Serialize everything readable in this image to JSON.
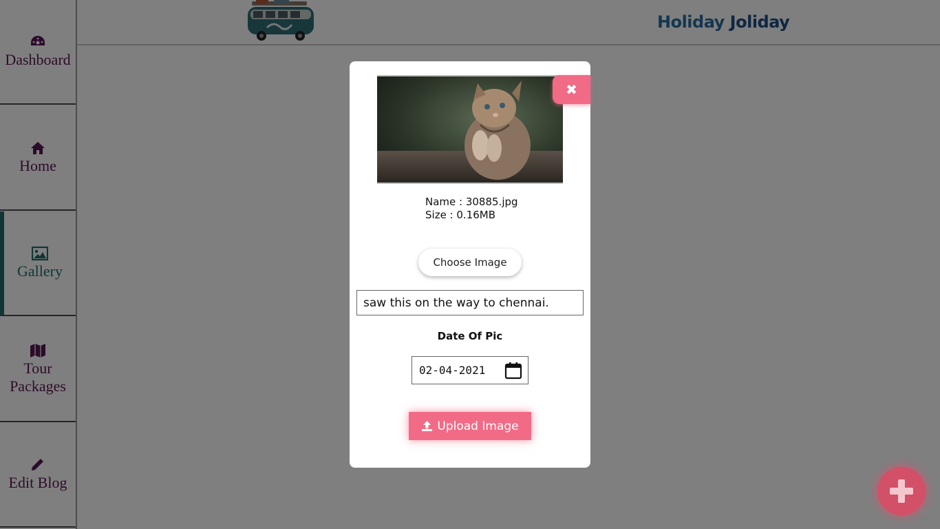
{
  "header": {
    "brand_word1": "Holiday",
    "brand_word2": "Joliday"
  },
  "sidebar": {
    "items": [
      {
        "label": "Dashboard",
        "icon": "dashboard-icon"
      },
      {
        "label": "Home",
        "icon": "home-icon"
      },
      {
        "label": "Gallery",
        "icon": "image-icon",
        "active": true
      },
      {
        "label_line1": "Tour",
        "label_line2": "Packages",
        "icon": "map-icon"
      },
      {
        "label": "Edit Blog",
        "icon": "pencil-icon"
      }
    ]
  },
  "modal": {
    "file_name": "Name : 30885.jpg",
    "file_size": "Size : 0.16MB",
    "choose_label": "Choose Image",
    "caption_value": "saw this on the way to chennai.",
    "date_label": "Date Of Pic",
    "date_value": "02-04-2021",
    "upload_label": "Upload Image",
    "close_icon": "close-icon"
  },
  "colors": {
    "accent": "#f26b86",
    "sidebar_text": "#5a1657",
    "sidebar_active": "#1e6c6a",
    "brand_blue": "#2a6fa0"
  }
}
